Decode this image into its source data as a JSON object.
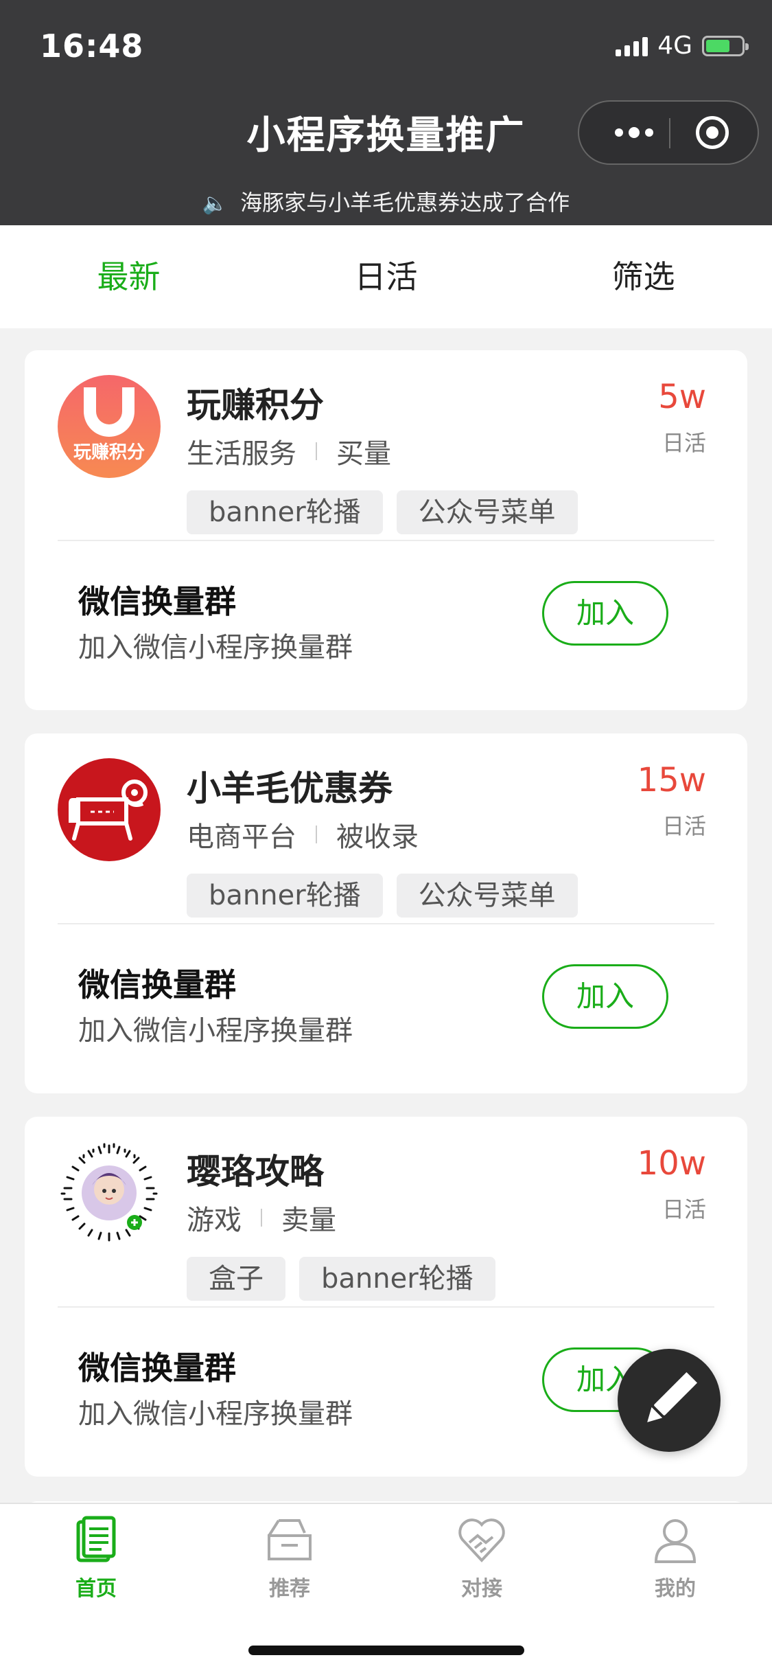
{
  "status_bar": {
    "time": "16:48",
    "network": "4G"
  },
  "header": {
    "title": "小程序换量推广"
  },
  "notice": {
    "text": "海豚家与小羊毛优惠券达成了合作"
  },
  "tabs": [
    {
      "label": "最新"
    },
    {
      "label": "日活"
    },
    {
      "label": "筛选"
    }
  ],
  "cards": [
    {
      "logo_text": "玩赚积分",
      "name": "玩赚积分",
      "category": "生活服务",
      "trade": "买量",
      "tags": [
        "banner轮播",
        "公众号菜单"
      ],
      "dau": "5w",
      "dau_label": "日活",
      "group_title": "微信换量群",
      "group_sub": "加入微信小程序换量群",
      "join_label": "加入"
    },
    {
      "name": "小羊毛优惠券",
      "category": "电商平台",
      "trade": "被收录",
      "tags": [
        "banner轮播",
        "公众号菜单"
      ],
      "dau": "15w",
      "dau_label": "日活",
      "group_title": "微信换量群",
      "group_sub": "加入微信小程序换量群",
      "join_label": "加入"
    },
    {
      "name": "璎珞攻略",
      "category": "游戏",
      "trade": "卖量",
      "tags": [
        "盒子",
        "banner轮播"
      ],
      "dau": "10w",
      "dau_label": "日活",
      "group_title": "微信换量群",
      "group_sub": "加入微信小程序换量群",
      "join_label": "加入"
    }
  ],
  "tabbar": [
    {
      "label": "首页",
      "icon": "home-doc-icon"
    },
    {
      "label": "推荐",
      "icon": "inbox-icon"
    },
    {
      "label": "对接",
      "icon": "handshake-heart-icon"
    },
    {
      "label": "我的",
      "icon": "user-icon"
    }
  ],
  "colors": {
    "accent": "#1aad19",
    "dau": "#e8483b",
    "header": "#3a3a3c"
  }
}
